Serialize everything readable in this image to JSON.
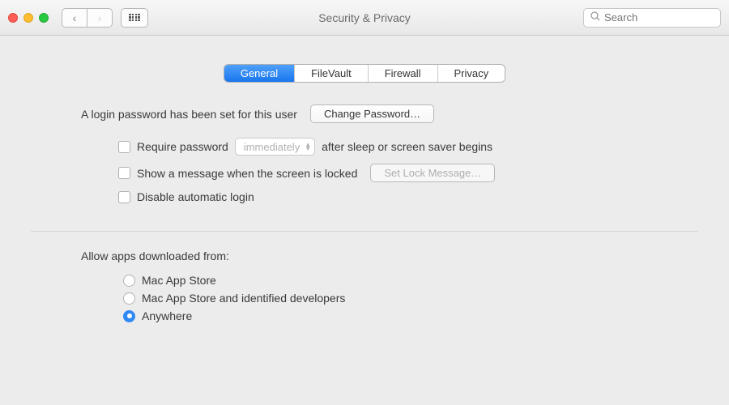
{
  "window": {
    "title": "Security & Privacy",
    "search_placeholder": "Search"
  },
  "tabs": [
    "General",
    "FileVault",
    "Firewall",
    "Privacy"
  ],
  "active_tab": 0,
  "general": {
    "login_password_label": "A login password has been set for this user",
    "change_password_button": "Change Password…",
    "require_password_label": "Require password",
    "require_password_delay": "immediately",
    "require_password_suffix": "after sleep or screen saver begins",
    "show_message_label": "Show a message when the screen is locked",
    "set_lock_message_button": "Set Lock Message…",
    "disable_auto_login_label": "Disable automatic login",
    "allow_apps_label": "Allow apps downloaded from:",
    "allow_options": [
      "Mac App Store",
      "Mac App Store and identified developers",
      "Anywhere"
    ],
    "allow_selected": 2
  }
}
